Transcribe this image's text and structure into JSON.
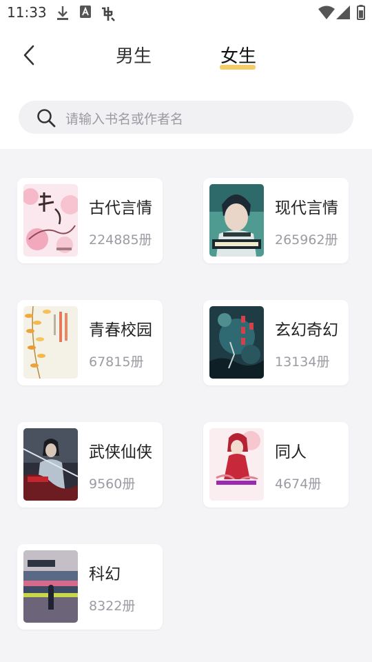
{
  "status_bar": {
    "time": "11:33"
  },
  "header": {
    "tabs": [
      {
        "label": "男生",
        "active": false
      },
      {
        "label": "女生",
        "active": true
      }
    ],
    "accent_color": "#f2cd6a"
  },
  "search": {
    "placeholder": "请输入书名或作者名"
  },
  "categories": [
    {
      "name": "古代言情",
      "count": "224885册",
      "cover": "pink-blossom"
    },
    {
      "name": "现代言情",
      "count": "265962册",
      "cover": "teal-portrait"
    },
    {
      "name": "青春校园",
      "count": "67815册",
      "cover": "autumn-leaves"
    },
    {
      "name": "玄幻奇幻",
      "count": "13134册",
      "cover": "dark-forest"
    },
    {
      "name": "武侠仙侠",
      "count": "9560册",
      "cover": "swordsman"
    },
    {
      "name": "同人",
      "count": "4674册",
      "cover": "red-girl"
    },
    {
      "name": "科幻",
      "count": "8322册",
      "cover": "glitch-city"
    }
  ]
}
